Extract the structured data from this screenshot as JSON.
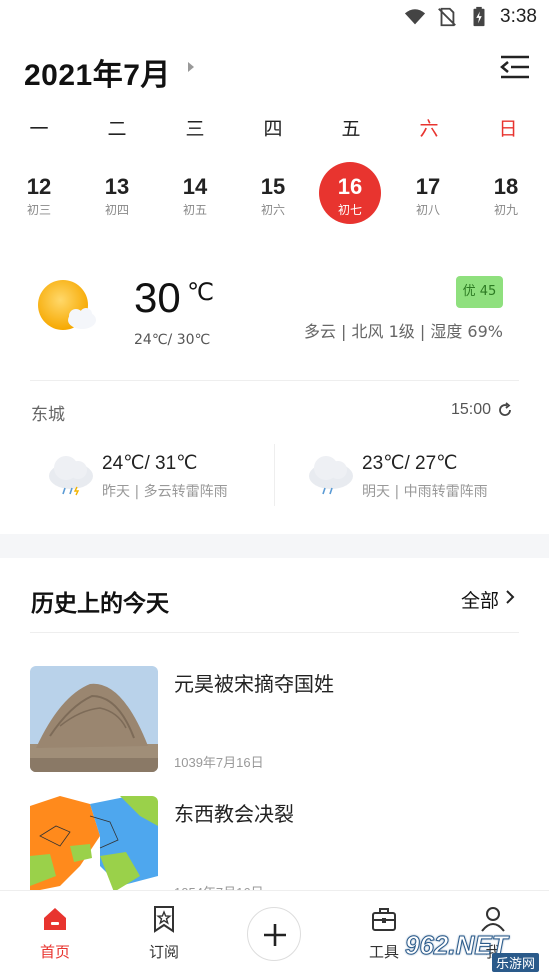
{
  "status_bar": {
    "time": "3:38"
  },
  "header": {
    "month_title": "2021年7月"
  },
  "week": {
    "days": [
      "一",
      "二",
      "三",
      "四",
      "五",
      "六",
      "日"
    ],
    "weekend_color": "#e8342f"
  },
  "dates": [
    {
      "num": "12",
      "lunar": "初三"
    },
    {
      "num": "13",
      "lunar": "初四"
    },
    {
      "num": "14",
      "lunar": "初五"
    },
    {
      "num": "15",
      "lunar": "初六"
    },
    {
      "num": "16",
      "lunar": "初七",
      "selected": true
    },
    {
      "num": "17",
      "lunar": "初八"
    },
    {
      "num": "18",
      "lunar": "初九"
    }
  ],
  "weather": {
    "current_temp": "30",
    "unit": "℃",
    "range": "24℃/ 30℃",
    "aqi": "优 45",
    "description": "多云 | 北风 1级 | 湿度 69%",
    "city": "东城",
    "updated": "15:00",
    "yesterday": {
      "temp": "24℃/ 31℃",
      "desc": "昨天 | 多云转雷阵雨"
    },
    "tomorrow": {
      "temp": "23℃/ 27℃",
      "desc": "明天 | 中雨转雷阵雨"
    }
  },
  "history": {
    "title": "历史上的今天",
    "all_label": "全部",
    "items": [
      {
        "title": "元昊被宋摘夺国姓",
        "date": "1039年7月16日"
      },
      {
        "title": "东西教会决裂",
        "date": "1054年7月16日"
      }
    ]
  },
  "nav": {
    "home": "首页",
    "subscribe": "订阅",
    "tools": "工具",
    "mine": "我"
  },
  "watermark": {
    "main": "962.NET",
    "sub": "乐游网"
  },
  "colors": {
    "accent": "#e8342f",
    "aqi_bg": "#8fe07e"
  }
}
